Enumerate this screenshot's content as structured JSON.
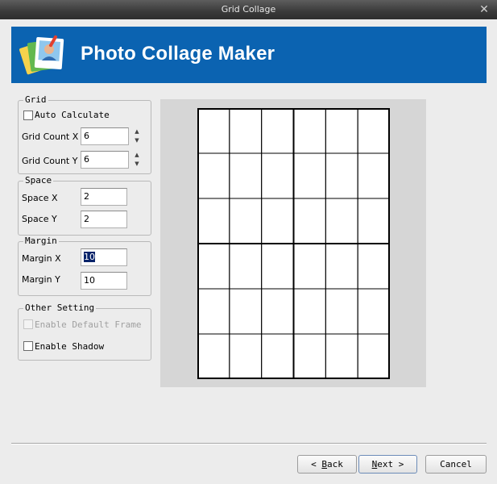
{
  "window": {
    "title": "Grid Collage",
    "close_glyph": "✕"
  },
  "banner": {
    "title": "Photo Collage Maker",
    "logo_icon": "photo-stack-logo",
    "background": "#0b63b1"
  },
  "grid": {
    "legend": "Grid",
    "auto_calculate_label": "Auto Calculate",
    "auto_calculate_checked": false,
    "count_x_label": "Grid Count X",
    "count_x_value": "6",
    "count_y_label": "Grid Count Y",
    "count_y_value": "6",
    "spin_up": "▲",
    "spin_down": "▼"
  },
  "space": {
    "legend": "Space",
    "x_label": "Space X",
    "x_value": "2",
    "y_label": "Space Y",
    "y_value": "2"
  },
  "margin": {
    "legend": "Margin",
    "x_label": "Margin X",
    "x_value": "10",
    "y_label": "Margin Y",
    "y_value": "10"
  },
  "other": {
    "legend": "Other Setting",
    "default_frame_label": "Enable Default Frame",
    "default_frame_enabled": false,
    "shadow_label": "Enable Shadow",
    "shadow_checked": false
  },
  "preview": {
    "columns": 6,
    "rows": 6
  },
  "buttons": {
    "back": {
      "arrow": "<",
      "mnemonic": "B",
      "rest": "ack"
    },
    "next": {
      "mnemonic": "N",
      "rest": "ext",
      "arrow": ">"
    },
    "cancel": "Cancel"
  }
}
